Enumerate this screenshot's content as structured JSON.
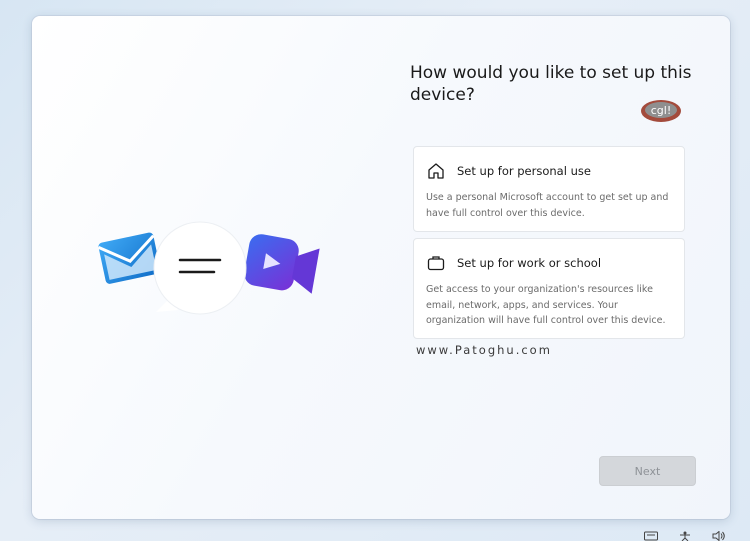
{
  "setup": {
    "title": "How would you like to set up this device?",
    "options": [
      {
        "icon": "home-icon",
        "label": "Set up for personal use",
        "description": "Use a personal Microsoft account to get set up and have full control over this device."
      },
      {
        "icon": "briefcase-icon",
        "label": "Set up for work or school",
        "description": "Get access to your organization's resources like email, network, apps, and services. Your organization will have full control over this device."
      }
    ],
    "next_label": "Next"
  },
  "watermark": {
    "site": "www.Patoghu.com",
    "logo_text": "cgl!"
  },
  "tray": {
    "icons": [
      "keyboard-icon",
      "accessibility-icon",
      "volume-icon"
    ]
  },
  "colors": {
    "mail_blue": "#1f8ce0",
    "video_purple": "#5b4ee0",
    "next_disabled": "#d4d7db"
  }
}
